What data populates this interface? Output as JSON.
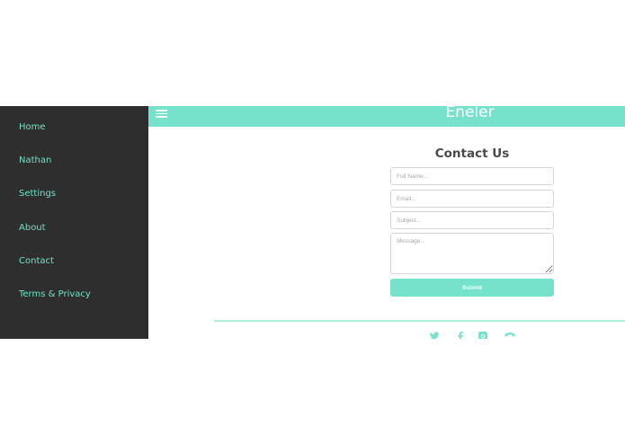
{
  "app": {
    "title": "Eneler"
  },
  "sidebar": {
    "items": [
      {
        "label": "Home"
      },
      {
        "label": "Nathan"
      },
      {
        "label": "Settings"
      },
      {
        "label": "About"
      },
      {
        "label": "Contact"
      },
      {
        "label": "Terms & Privacy"
      }
    ]
  },
  "contact": {
    "title": "Contact Us",
    "full_name_placeholder": "Full Name...",
    "email_placeholder": "Email...",
    "subject_placeholder": "Subject...",
    "message_placeholder": "Message...",
    "submit_label": "Submit"
  },
  "footer": {
    "social_icons": [
      "twitter-icon",
      "facebook-icon",
      "instagram-icon",
      "phone-icon"
    ]
  },
  "colors": {
    "accent": "#76e2cc",
    "sidebar_bg": "#2e2e2e",
    "sidebar_text": "#6ee3c8",
    "heading_text": "#4a4a4a"
  }
}
